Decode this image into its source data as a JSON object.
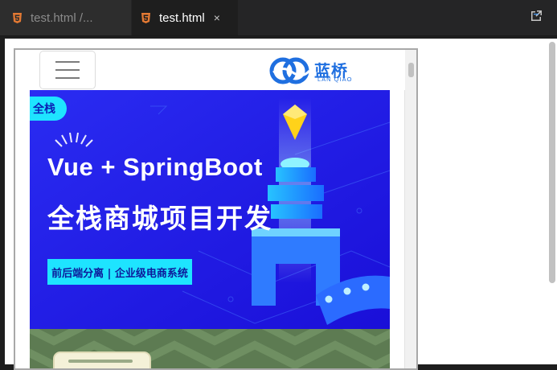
{
  "editor": {
    "tabs": [
      {
        "label": "test.html /...",
        "active": false
      },
      {
        "label": "test.html",
        "active": true
      }
    ],
    "close_glyph": "×",
    "open_preview_icon": "open-preview-icon",
    "colors": {
      "tab_bg": "#252526",
      "active_tab_bg": "#1e1e1e",
      "html_icon": "#e37933"
    }
  },
  "site": {
    "logo": {
      "cn": "蓝桥",
      "en": "LAN QIAO",
      "color": "#1f6fe0"
    },
    "menu_icon": "hamburger-menu-icon",
    "banner": {
      "tag": "全栈",
      "headline_en": "Vue + SpringBoot",
      "headline_cn": "全栈商城项目开发",
      "subtitle": "前后端分离 | 企业级电商系统",
      "colors": {
        "background": "#1f15e6",
        "accent": "#1ee4ff"
      }
    }
  }
}
